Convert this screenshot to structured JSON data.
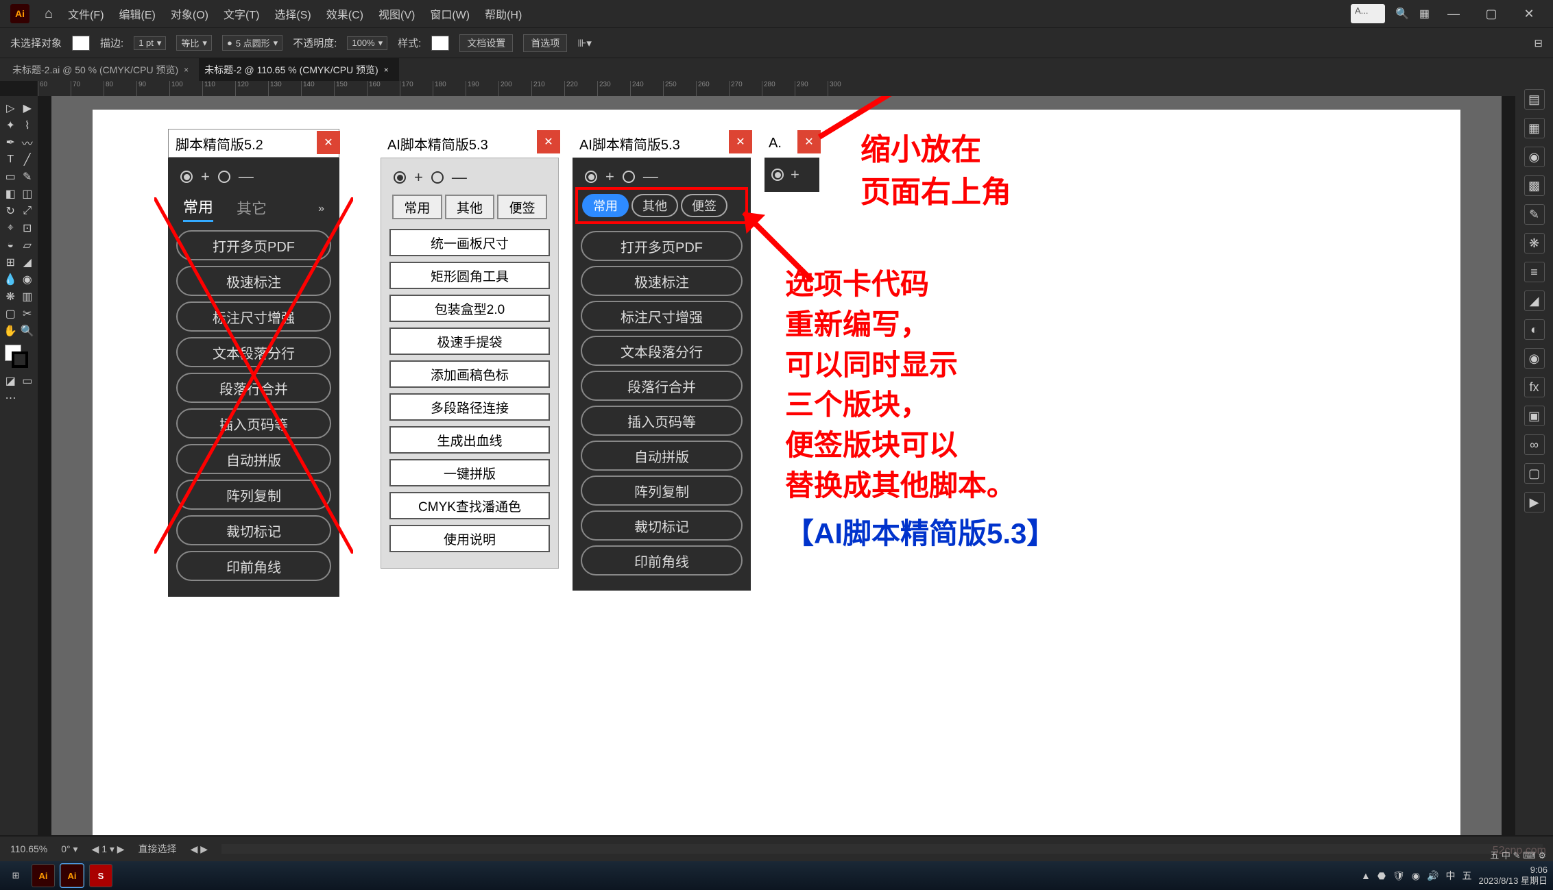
{
  "menubar": {
    "items": [
      "文件(F)",
      "编辑(E)",
      "对象(O)",
      "文字(T)",
      "选择(S)",
      "效果(C)",
      "视图(V)",
      "窗口(W)",
      "帮助(H)"
    ],
    "search_placeholder": "A..."
  },
  "optbar": {
    "noselection": "未选择对象",
    "stroke_label": "描边:",
    "stroke_val": "1 pt",
    "uniform": "等比",
    "brush_val": "5 点圆形",
    "opacity_label": "不透明度:",
    "opacity_val": "100%",
    "style_label": "样式:",
    "docsetup": "文档设置",
    "prefs": "首选项"
  },
  "tabs": {
    "tab1": "未标题-2.ai @ 50 % (CMYK/CPU 预览)",
    "tab2": "未标题-2 @ 110.65 % (CMYK/CPU 预览)"
  },
  "ruler_marks": [
    "60",
    "70",
    "80",
    "90",
    "100",
    "110",
    "120",
    "130",
    "140",
    "150",
    "160",
    "170",
    "180",
    "190",
    "200",
    "210",
    "220",
    "230",
    "240",
    "250",
    "260",
    "270",
    "280",
    "290",
    "300"
  ],
  "panel1": {
    "title": "脚本精简版5.2",
    "tabs": [
      "常用",
      "其它"
    ],
    "buttons": [
      "打开多页PDF",
      "极速标注",
      "标注尺寸增强",
      "文本段落分行",
      "段落行合并",
      "插入页码等",
      "自动拼版",
      "阵列复制",
      "裁切标记",
      "印前角线"
    ]
  },
  "panel2": {
    "title": "AI脚本精简版5.3",
    "tabs": [
      "常用",
      "其他",
      "便签"
    ],
    "buttons": [
      "统一画板尺寸",
      "矩形圆角工具",
      "包装盒型2.0",
      "极速手提袋",
      "添加画稿色标",
      "多段路径连接",
      "生成出血线",
      "一键拼版",
      "CMYK查找潘通色",
      "使用说明"
    ]
  },
  "panel3": {
    "title": "AI脚本精简版5.3",
    "tabs": [
      "常用",
      "其他",
      "便签"
    ],
    "buttons": [
      "打开多页PDF",
      "极速标注",
      "标注尺寸增强",
      "文本段落分行",
      "段落行合并",
      "插入页码等",
      "自动拼版",
      "阵列复制",
      "裁切标记",
      "印前角线"
    ]
  },
  "panel4": {
    "title": "A."
  },
  "anno": {
    "a1": "缩小放在\n页面右上角",
    "a2": "选项卡代码\n重新编写，\n可以同时显示\n三个版块，\n便签版块可以\n替换成其他脚本。",
    "a3": "【AI脚本精简版5.3】"
  },
  "status": {
    "zoom": "110.65%",
    "mode": "直接选择"
  },
  "taskbar": {
    "time": "9:06",
    "date": "2023/8/13 星期日"
  },
  "watermark": "52cnp.com"
}
